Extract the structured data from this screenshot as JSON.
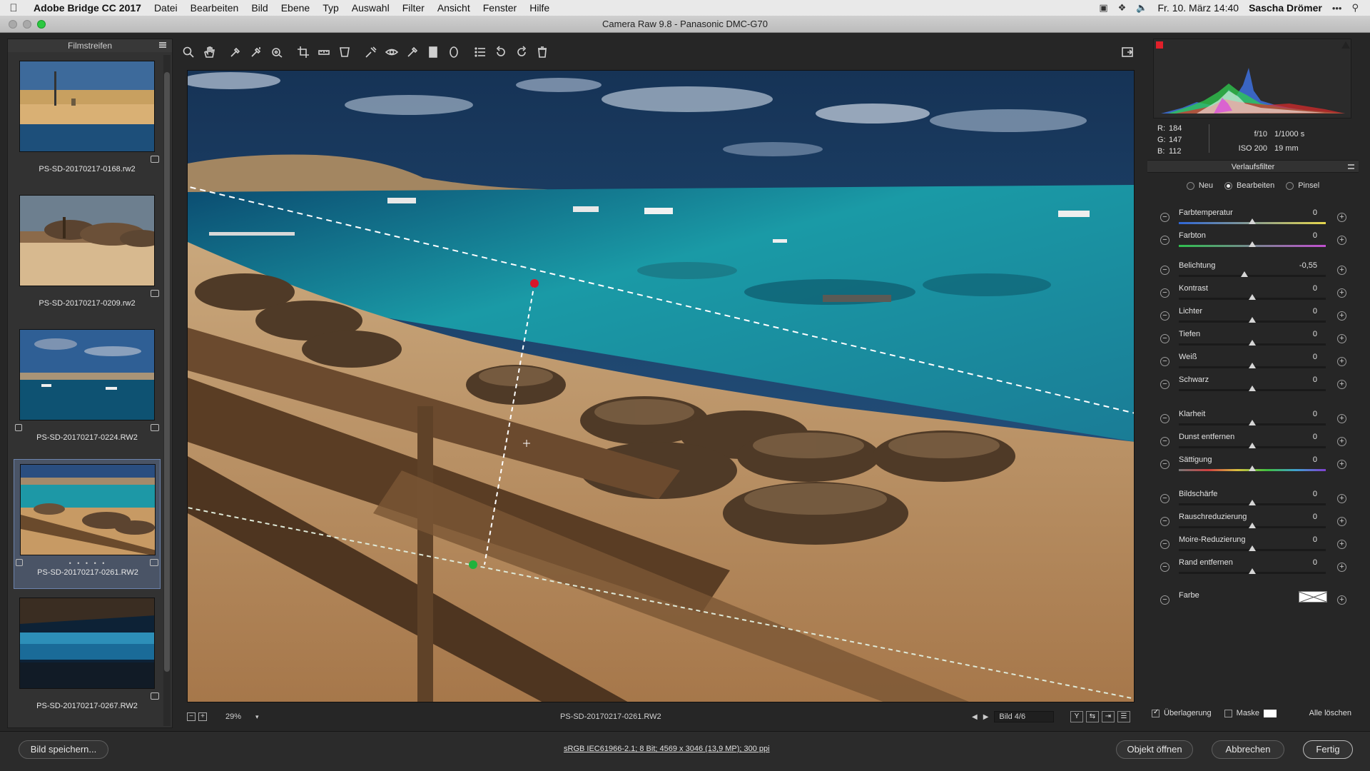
{
  "menubar": {
    "app": "Adobe Bridge CC 2017",
    "items": [
      "Datei",
      "Bearbeiten",
      "Bild",
      "Ebene",
      "Typ",
      "Auswahl",
      "Filter",
      "Ansicht",
      "Fenster",
      "Hilfe"
    ],
    "clock": "Fr. 10. März  14:40",
    "user": "Sascha Drömer"
  },
  "window": {
    "title": "Camera Raw 9.8 - Panasonic DMC-G70"
  },
  "filmstrip": {
    "title": "Filmstreifen",
    "items": [
      {
        "label": "PS-SD-20170217-0168.rw2"
      },
      {
        "label": "PS-SD-20170217-0209.rw2"
      },
      {
        "label": "PS-SD-20170217-0224.RW2"
      },
      {
        "label": "PS-SD-20170217-0261.RW2",
        "dots": "• • • • •"
      },
      {
        "label": "PS-SD-20170217-0267.RW2"
      }
    ]
  },
  "preview": {
    "filename": "PS-SD-20170217-0261.RW2",
    "zoom": "29%",
    "image_counter": "Bild 4/6"
  },
  "histogram": {
    "r": "184",
    "g": "147",
    "b": "112",
    "r_key": "R:",
    "g_key": "G:",
    "b_key": "B:",
    "aperture": "f/10",
    "shutter": "1/1000 s",
    "iso": "ISO 200",
    "focal": "19 mm"
  },
  "panel": {
    "title": "Verlaufsfilter",
    "modes": [
      "Neu",
      "Bearbeiten",
      "Pinsel"
    ],
    "active_mode": "Bearbeiten",
    "sliders": [
      {
        "label": "Farbtemperatur",
        "value": "0",
        "level": 0.5
      },
      {
        "label": "Farbton",
        "value": "0",
        "level": 0.5
      },
      {
        "label": "Belichtung",
        "value": "-0,55",
        "level": 0.445
      },
      {
        "label": "Kontrast",
        "value": "0",
        "level": 0.5
      },
      {
        "label": "Lichter",
        "value": "0",
        "level": 0.5
      },
      {
        "label": "Tiefen",
        "value": "0",
        "level": 0.5
      },
      {
        "label": "Weiß",
        "value": "0",
        "level": 0.5
      },
      {
        "label": "Schwarz",
        "value": "0",
        "level": 0.5
      },
      {
        "label": "Klarheit",
        "value": "0",
        "level": 0.5
      },
      {
        "label": "Dunst entfernen",
        "value": "0",
        "level": 0.5
      },
      {
        "label": "Sättigung",
        "value": "0",
        "level": 0.5
      },
      {
        "label": "Bildschärfe",
        "value": "0",
        "level": 0.5
      },
      {
        "label": "Rauschreduzierung",
        "value": "0",
        "level": 0.5
      },
      {
        "label": "Moire-Reduzierung",
        "value": "0",
        "level": 0.5
      },
      {
        "label": "Rand entfernen",
        "value": "0",
        "level": 0.5
      }
    ],
    "color_label": "Farbe",
    "overlay_label": "Überlagerung",
    "mask_label": "Maske",
    "clear_all": "Alle löschen"
  },
  "footer": {
    "save_label": "Bild speichern...",
    "workflow": "sRGB IEC61966-2.1; 8 Bit; 4569 x 3046 (13,9 MP); 300 ppi",
    "open_label": "Objekt öffnen",
    "cancel_label": "Abbrechen",
    "done_label": "Fertig"
  },
  "icons": {
    "toolbar": [
      "zoom-icon",
      "hand-icon",
      "white-balance-icon",
      "color-sampler-icon",
      "target-adjustment-icon",
      "crop-icon",
      "straighten-icon",
      "transform-icon",
      "spot-removal-icon",
      "red-eye-icon",
      "adjustment-brush-icon",
      "graduated-filter-icon",
      "radial-filter-icon",
      "preferences-icon",
      "rotate-left-icon",
      "rotate-right-icon",
      "trash-icon",
      "fullscreen-icon"
    ]
  },
  "colors": {
    "accent_selected": "#6c83ad",
    "filter_start_pin": "#d8172a",
    "filter_end_pin": "#22b23c"
  }
}
